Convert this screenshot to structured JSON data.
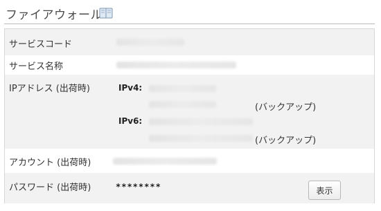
{
  "header": {
    "title": "ファイアウォール",
    "help_icon": "book-icon"
  },
  "rows": {
    "service_code": {
      "label": "サービスコード",
      "value_masked": true
    },
    "service_name": {
      "label": "サービス名称",
      "value_masked": true
    },
    "ip_address": {
      "label": "IPアドレス (出荷時)",
      "ipv4_label": "IPv4:",
      "ipv6_label": "IPv6:",
      "backup_note": "(バックアップ)"
    },
    "account": {
      "label": "アカウント (出荷時)",
      "value_masked": true
    },
    "password": {
      "label": "パスワード (出荷時)",
      "value": "********",
      "show_button": "表示"
    }
  }
}
